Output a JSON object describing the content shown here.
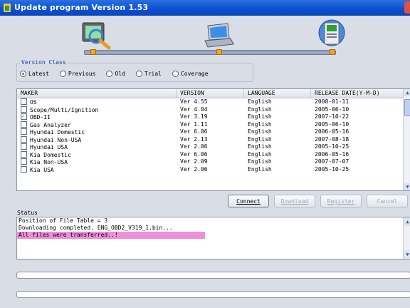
{
  "window": {
    "title": "Update program Version 1.53"
  },
  "steps": [
    "pc-scan-icon",
    "laptop-icon",
    "device-update-icon"
  ],
  "version_class": {
    "legend": "Version Class",
    "options": [
      "Latest",
      "Previous",
      "Old",
      "Trial",
      "Coverage"
    ],
    "selected": "Latest"
  },
  "table": {
    "columns": [
      "MAKER",
      "VERSION",
      "LANGUAGE",
      "RELEASE DATE(Y-M-D)"
    ],
    "rows": [
      {
        "maker": "OS",
        "version": "Ver 4.55",
        "language": "English",
        "date": "2008-01-11",
        "checked": false
      },
      {
        "maker": "Scope/Multi/Ignition",
        "version": "Ver 4.04",
        "language": "English",
        "date": "2005-06-10",
        "checked": false
      },
      {
        "maker": "OBD-II",
        "version": "Ver 3.19",
        "language": "English",
        "date": "2007-10-22",
        "checked": true
      },
      {
        "maker": "Gas Analyzer",
        "version": "Ver 1.11",
        "language": "English",
        "date": "2005-06-10",
        "checked": false
      },
      {
        "maker": "Hyundai Domestic",
        "version": "Ver 6.06",
        "language": "English",
        "date": "2006-05-16",
        "checked": false
      },
      {
        "maker": "Hyundai Non-USA",
        "version": "Ver 2.13",
        "language": "English",
        "date": "2007-08-18",
        "checked": false
      },
      {
        "maker": "Hyundai USA",
        "version": "Ver 2.06",
        "language": "English",
        "date": "2005-10-25",
        "checked": false
      },
      {
        "maker": "Kia Domestic",
        "version": "Ver 6.06",
        "language": "English",
        "date": "2006-05-16",
        "checked": false
      },
      {
        "maker": "Kia Non-USA",
        "version": "Ver 2.09",
        "language": "English",
        "date": "2007-07-07",
        "checked": false
      },
      {
        "maker": "Kia USA",
        "version": "Ver 2.06",
        "language": "English",
        "date": "2005-10-25",
        "checked": false
      }
    ]
  },
  "buttons": {
    "connect": "Connect",
    "download": "Download",
    "register": "Register",
    "cancel": "Cancel"
  },
  "status": {
    "label": "Status",
    "lines": [
      "Position of File Table = 3",
      "Downloading completed. ENG_OBD2_V319_1.bin...",
      "All files were transferred..!"
    ]
  },
  "progress": [
    {
      "value": 0
    },
    {
      "value": 0
    }
  ],
  "colors": {
    "title_bar": "#0a4fd0",
    "highlight": "#f08fd9",
    "selected_radio": "#2aa12e"
  }
}
